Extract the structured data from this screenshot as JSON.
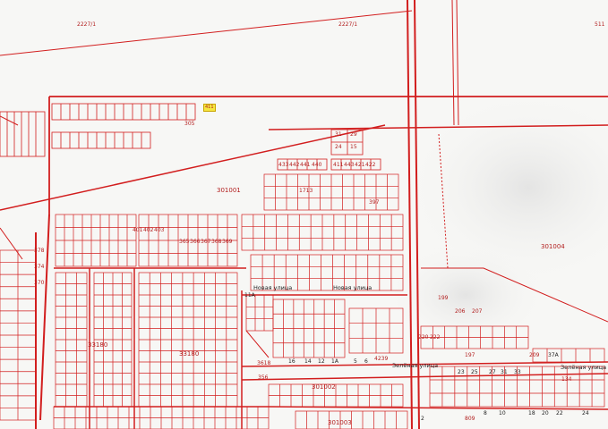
{
  "map": {
    "style": {
      "background": "#f7f7f5",
      "boundary_color": "#d21e1e",
      "selected_fill": "#f5e640",
      "text_dark": "#222222"
    },
    "cadastral_blocks": {
      "top_left": "2227/1",
      "top_mid": "2227/1",
      "top_right": "511",
      "quarter_301001": "301001",
      "quarter_301004": "301004",
      "quarter_301002": "301002",
      "quarter_301003": "301003",
      "quarter_33180": "33180",
      "quarter_33180b": "33180"
    },
    "streets": {
      "novaya_1": "Новая улица",
      "novaya_2": "Новая улица",
      "zelenaya_1": "Зелёная улица",
      "zelenaya_2": "Зелёная улица"
    },
    "selected_parcel": "411",
    "parcels": {
      "p31": "31",
      "p29": "29",
      "p24": "24",
      "p15": "15",
      "p433": "433",
      "p442": "442",
      "p441": "441",
      "p440": "440",
      "p411": "411",
      "p443": "443",
      "p421": "421",
      "p422": "422",
      "p1713": "1713",
      "p305": "305",
      "p397": "397",
      "p199": "199",
      "p206": "206",
      "p207": "207",
      "p209": "209",
      "p197": "197",
      "p356": "356",
      "p361": "3618",
      "p4239": "4239",
      "p11": "11",
      "p16": "16",
      "p14": "14",
      "p12": "12",
      "p11a": "11A",
      "p1a": "1A",
      "p5": "5",
      "p6": "6",
      "p23": "23",
      "p25": "25",
      "p27": "27",
      "p31b": "31",
      "p33": "33",
      "p37a": "37A",
      "p20": "20",
      "p22": "22",
      "p18": "18",
      "p10": "10",
      "p8": "8",
      "p24b": "24",
      "p809": "809",
      "p222": "222",
      "p220": "220",
      "p2": "2",
      "p134": "134",
      "p378": "378",
      "p374": "374",
      "p370": "370",
      "p401": "401",
      "p402": "402",
      "p403": "403",
      "p365": "365",
      "p366": "366",
      "p367": "367",
      "p368": "368",
      "p369": "369"
    }
  }
}
